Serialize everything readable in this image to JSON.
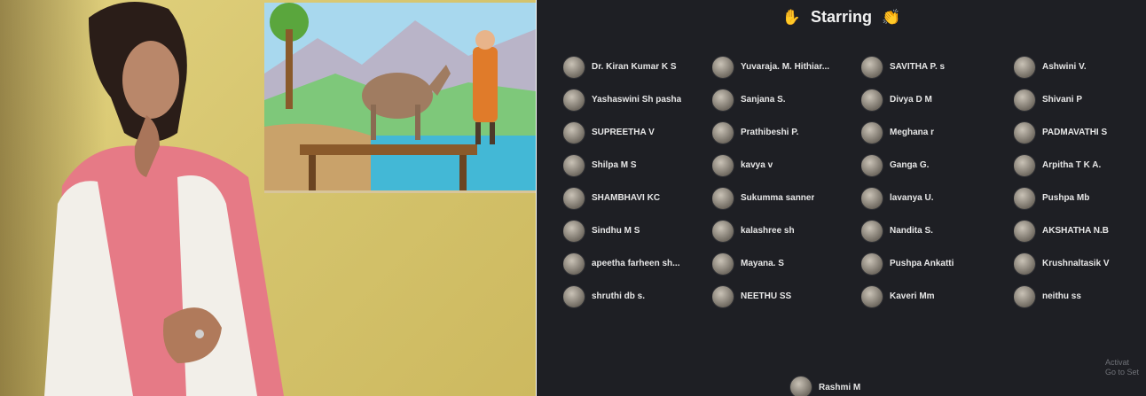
{
  "panel": {
    "title": "Starring",
    "title_icon_left": "raised-hands-icon",
    "title_icon_right": "clapping-hands-icon",
    "watermark_line1": "Activat",
    "watermark_line2": "Go to Set"
  },
  "people": [
    "Dr. Kiran Kumar K S",
    "Yuvaraja. M. Hithiar...",
    "SAVITHA P. s",
    "Ashwini V.",
    "Yashaswini Sh pasha",
    "Sanjana S.",
    "Divya D M",
    "Shivani P",
    "SUPREETHA V",
    "Prathibeshi P.",
    "Meghana r",
    "PADMAVATHI S",
    "Shilpa M S",
    "kavya v",
    "Ganga G.",
    "Arpitha T K A.",
    "SHAMBHAVI KC",
    "Sukumma sanner",
    "lavanya U.",
    "Pushpa Mb",
    "Sindhu M S",
    "kalashree sh",
    "Nandita S.",
    "AKSHATHA N.B",
    "apeetha farheen sh...",
    "Mayana. S",
    "Pushpa Ankatti",
    "Krushnaltasik V",
    "shruthi db s.",
    "NEETHU SS",
    "Kaveri Mm",
    "neithu ss"
  ],
  "last_person": "Rashmi M",
  "colors": {
    "panel_bg": "#1e1f24",
    "text": "#e7e7e7",
    "accent": "#f5c23a"
  }
}
